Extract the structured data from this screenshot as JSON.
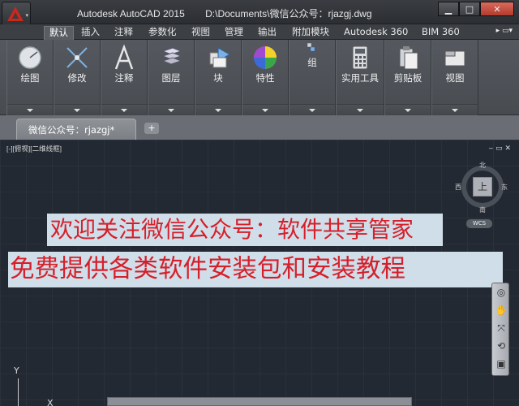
{
  "window": {
    "app_title": "Autodesk AutoCAD 2015",
    "file_path": "D:\\Documents\\微信公众号：rjazgj.dwg",
    "min_glyph": "▁",
    "max_glyph": "□",
    "close_glyph": "✕"
  },
  "menu_tabs": [
    "默认",
    "插入",
    "注释",
    "参数化",
    "视图",
    "管理",
    "输出",
    "附加模块",
    "Autodesk 360",
    "BIM 360"
  ],
  "menu_extra": "▸ ▭▾",
  "ribbon": {
    "panels": [
      {
        "label": "绘图",
        "icon": "circle-draw-icon"
      },
      {
        "label": "修改",
        "icon": "move-arrows-icon"
      },
      {
        "label": "注释",
        "icon": "letter-a-icon"
      },
      {
        "label": "图层",
        "icon": "layers-icon"
      },
      {
        "label": "块",
        "icon": "block-insert-icon"
      },
      {
        "label": "特性",
        "icon": "color-wheel-icon"
      },
      {
        "label": "组",
        "icon": "group-icon"
      },
      {
        "label": "实用工具",
        "icon": "calculator-icon"
      },
      {
        "label": "剪贴板",
        "icon": "clipboard-icon"
      },
      {
        "label": "视图",
        "icon": "view-icon"
      }
    ]
  },
  "document_tab": {
    "label": "微信公众号：rjazgj*",
    "add": "+"
  },
  "viewport": {
    "controls": "[-][俯视][二维线框]",
    "win_buttons": "‒ ▭ ✕"
  },
  "viewcube": {
    "top": "上",
    "north": "北",
    "south": "南",
    "east": "东",
    "west": "西",
    "wcs": "WCS"
  },
  "banners": {
    "line1": "欢迎关注微信公众号：软件共享管家",
    "line2": "免费提供各类软件安装包和安装教程"
  },
  "ucs": {
    "y": "Y",
    "x": "X"
  },
  "colors": {
    "accent_red": "#d61f2a",
    "banner_bg": "#d6e6f0",
    "canvas": "#232933"
  }
}
